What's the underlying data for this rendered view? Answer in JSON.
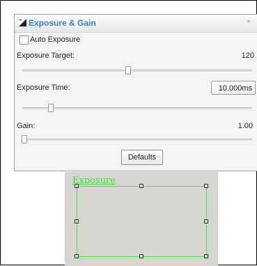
{
  "panel": {
    "title": "Exposure & Gain",
    "icon": "exposure-icon",
    "collapse_icon": "»"
  },
  "auto_exposure": {
    "label": "Auto Exposure",
    "checked": false
  },
  "exposure_target": {
    "label": "Exposure Target:",
    "value": "120",
    "slider_fraction": 0.5
  },
  "exposure_time": {
    "label": "Exposure Time:",
    "value": "10.000ms",
    "slider_fraction": 0.13
  },
  "gain": {
    "label": "Gain:",
    "value": "1.00",
    "slider_fraction": 0.0
  },
  "defaults_button": "Defaults",
  "preview": {
    "roi_label": "Exposure",
    "roi_color": "#48e048"
  }
}
